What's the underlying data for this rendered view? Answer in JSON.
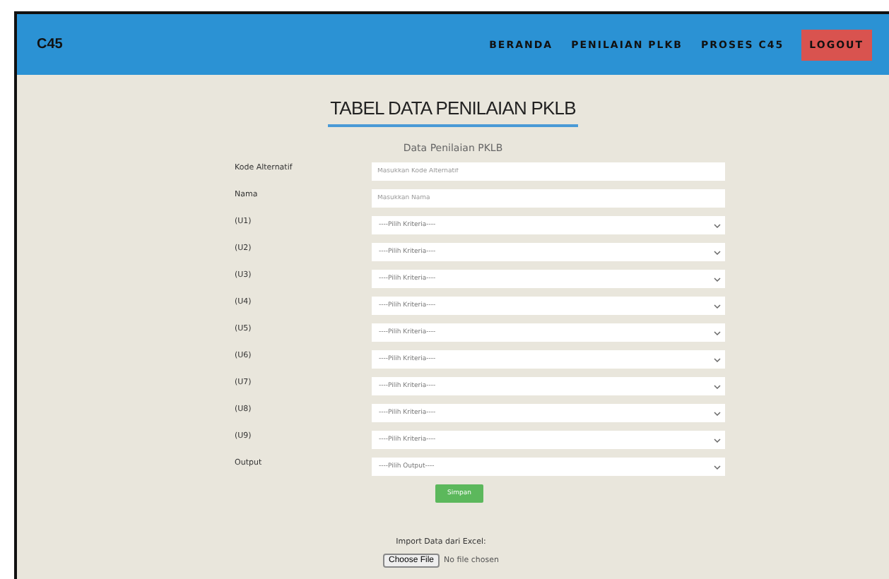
{
  "navbar": {
    "brand": "C45",
    "items": [
      {
        "label": "BERANDA",
        "kind": "link"
      },
      {
        "label": "PENILAIAN PLKB",
        "kind": "link"
      },
      {
        "label": "PROSES C45",
        "kind": "link"
      },
      {
        "label": "LOGOUT",
        "kind": "button"
      }
    ]
  },
  "title": "TABEL DATA PENILAIAN PKLB",
  "form": {
    "heading": "Data Penilaian PKLB",
    "fields": [
      {
        "label": "Kode Alternatif",
        "kind": "input",
        "placeholder": "Masukkan Kode Alternatif"
      },
      {
        "label": "Nama",
        "kind": "input",
        "placeholder": "Masukkan Nama"
      },
      {
        "label": "(U1)",
        "kind": "select",
        "value": "----Pilih Kriteria----"
      },
      {
        "label": "(U2)",
        "kind": "select",
        "value": "----Pilih Kriteria----"
      },
      {
        "label": "(U3)",
        "kind": "select",
        "value": "----Pilih Kriteria----"
      },
      {
        "label": "(U4)",
        "kind": "select",
        "value": "----Pilih Kriteria----"
      },
      {
        "label": "(U5)",
        "kind": "select",
        "value": "----Pilih Kriteria----"
      },
      {
        "label": "(U6)",
        "kind": "select",
        "value": "----Pilih Kriteria----"
      },
      {
        "label": "(U7)",
        "kind": "select",
        "value": "----Pilih Kriteria----"
      },
      {
        "label": "(U8)",
        "kind": "select",
        "value": "----Pilih Kriteria----"
      },
      {
        "label": "(U9)",
        "kind": "select",
        "value": "----Pilih Kriteria----"
      },
      {
        "label": "Output",
        "kind": "select",
        "value": "----Pilih Output----"
      }
    ],
    "submit": "Simpan"
  },
  "import": {
    "label": "Import Data dari Excel:",
    "button": "Choose File",
    "status": "No file chosen"
  }
}
